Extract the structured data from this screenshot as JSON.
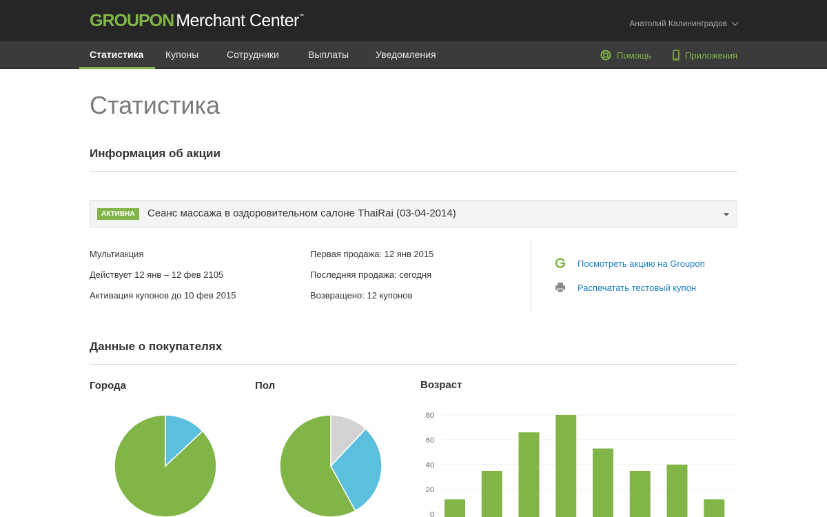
{
  "header": {
    "logo_brand": "GROUPON",
    "logo_product": "Merchant Center",
    "logo_tm": "™",
    "user_name": "Анатолий Калининградов"
  },
  "nav": {
    "tabs": [
      {
        "label": "Статистика",
        "active": true
      },
      {
        "label": "Купоны"
      },
      {
        "label": "Сотрудники"
      },
      {
        "label": "Выплаты"
      },
      {
        "label": "Уведомления"
      }
    ],
    "help_label": "Помощь",
    "apps_label": "Приложения"
  },
  "page": {
    "title": "Статистика"
  },
  "deal_info": {
    "section_title": "Информация об акции",
    "status_badge": "АКТИВНА",
    "selected_deal": "Сеанс массажа в оздоровительном салоне ThaiRai (03-04-2014)",
    "col1": [
      "Мультиакция",
      "Действует 12 янв – 12 фев 2105",
      "Активация купонов до 10 фев 2015"
    ],
    "col2": [
      "Первая продажа: 12 янв 2015",
      "Последняя продажа: сегодня",
      "Возвращено: 12 купонов"
    ],
    "links": {
      "view_on_groupon": "Посмотреть акцию на Groupon",
      "print_test_coupon": "Распечатать тестовый купон"
    }
  },
  "customers": {
    "section_title": "Данные о покупателях",
    "cities_title": "Города",
    "gender_title": "Пол",
    "age_title": "Возраст"
  },
  "colors": {
    "brand_green": "#82b548",
    "blue": "#5bc0de",
    "grey": "#d3d3d3",
    "link": "#1a7fbf"
  },
  "chart_data": [
    {
      "type": "pie",
      "title": "Города",
      "slices": [
        {
          "value": 87,
          "color": "#82b548"
        },
        {
          "value": 13,
          "color": "#5bc0de"
        }
      ]
    },
    {
      "type": "pie",
      "title": "Пол",
      "slices": [
        {
          "value": 58,
          "color": "#82b548"
        },
        {
          "value": 30,
          "color": "#5bc0de"
        },
        {
          "value": 12,
          "color": "#d3d3d3"
        }
      ]
    },
    {
      "type": "bar",
      "title": "Возраст",
      "values": [
        12,
        35,
        66,
        80,
        53,
        35,
        40,
        12
      ],
      "ylim": [
        0,
        80
      ],
      "yticks": [
        0,
        20,
        40,
        60,
        80
      ],
      "grid": true,
      "color": "#82b548"
    }
  ]
}
